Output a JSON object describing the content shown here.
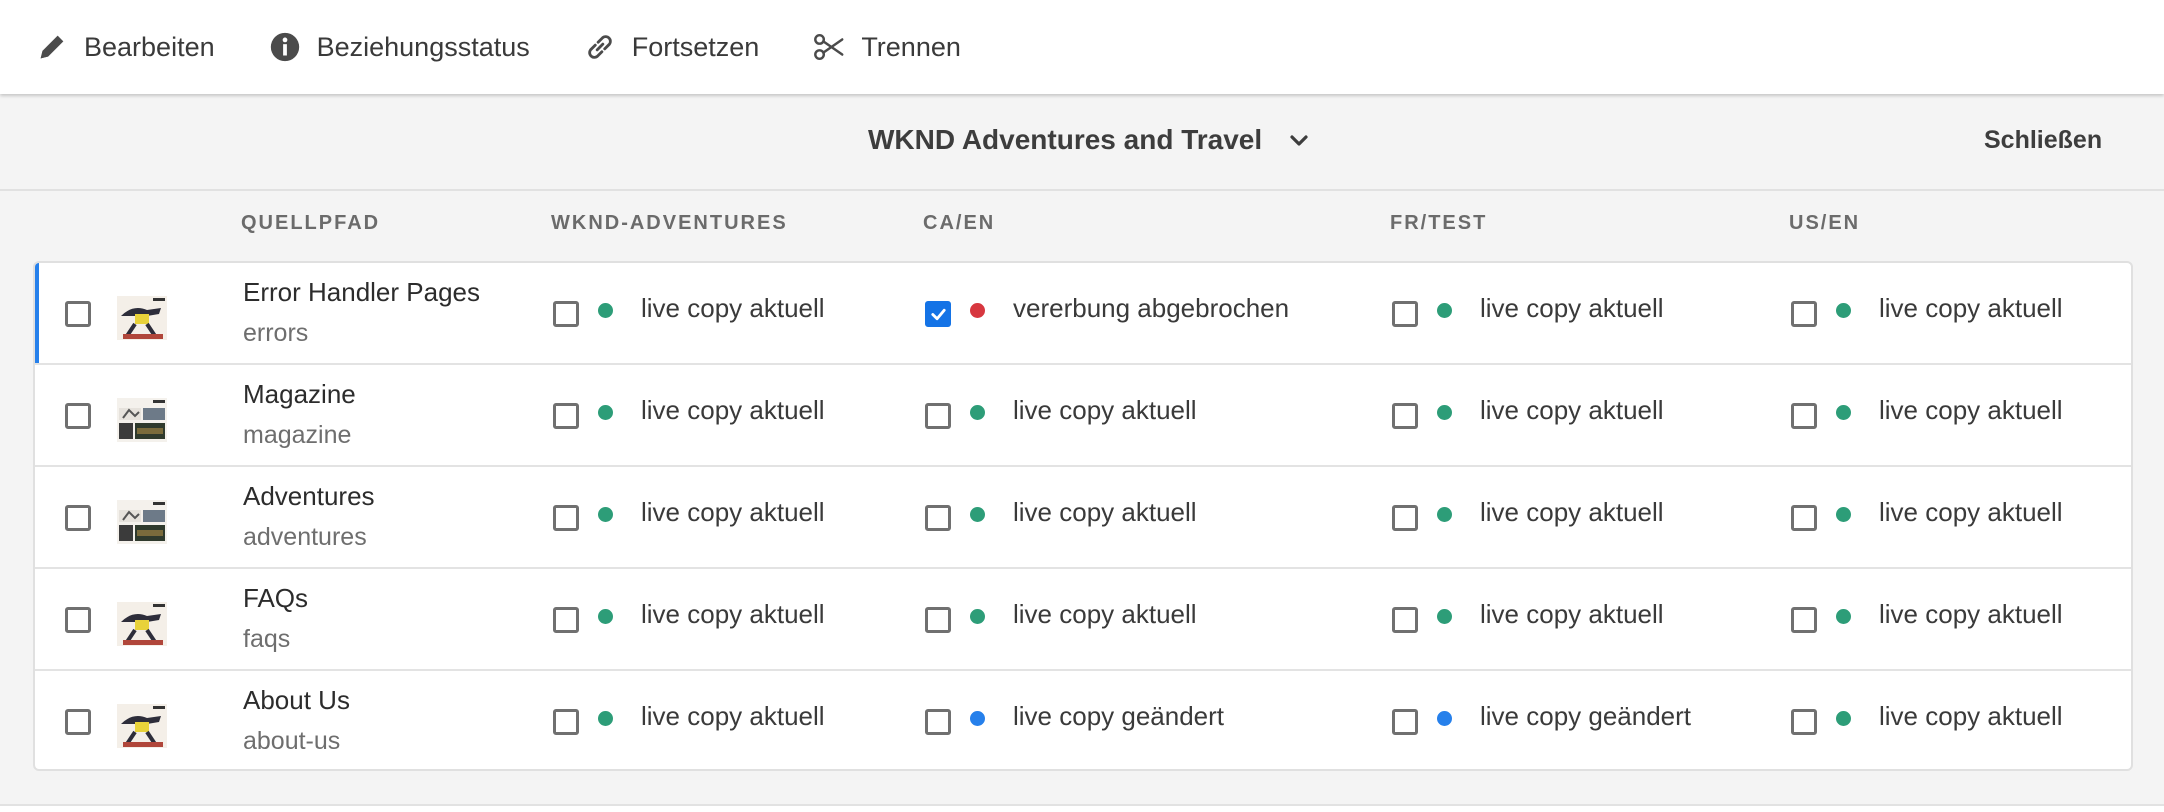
{
  "toolbar": {
    "items": [
      {
        "label": "Bearbeiten",
        "icon": "pencil-icon"
      },
      {
        "label": "Beziehungsstatus",
        "icon": "info-icon"
      },
      {
        "label": "Fortsetzen",
        "icon": "link-icon"
      },
      {
        "label": "Trennen",
        "icon": "scissors-icon"
      }
    ]
  },
  "panel": {
    "site_title": "WKND Adventures and Travel",
    "close_label": "Schließen"
  },
  "columns": {
    "source": "QUELLPFAD",
    "live_copies": [
      "WKND-ADVENTURES",
      "CA/EN",
      "FR/TEST",
      "US/EN"
    ]
  },
  "colors": {
    "status_ok": "#2d9d78",
    "status_broken": "#d7373f",
    "status_changed": "#2680eb",
    "selection_accent": "#2680eb"
  },
  "rows": [
    {
      "title": "Error Handler Pages",
      "path": "errors",
      "selected": true,
      "thumb": "single-figure",
      "cells": [
        {
          "text": "live copy aktuell",
          "state": "ok",
          "checked": false
        },
        {
          "text": "vererbung abgebrochen",
          "state": "broken",
          "checked": true
        },
        {
          "text": "live copy aktuell",
          "state": "ok",
          "checked": false
        },
        {
          "text": "live copy aktuell",
          "state": "ok",
          "checked": false
        }
      ]
    },
    {
      "title": "Magazine",
      "path": "magazine",
      "selected": false,
      "thumb": "collage",
      "cells": [
        {
          "text": "live copy aktuell",
          "state": "ok",
          "checked": false
        },
        {
          "text": "live copy aktuell",
          "state": "ok",
          "checked": false
        },
        {
          "text": "live copy aktuell",
          "state": "ok",
          "checked": false
        },
        {
          "text": "live copy aktuell",
          "state": "ok",
          "checked": false
        }
      ]
    },
    {
      "title": "Adventures",
      "path": "adventures",
      "selected": false,
      "thumb": "collage",
      "cells": [
        {
          "text": "live copy aktuell",
          "state": "ok",
          "checked": false
        },
        {
          "text": "live copy aktuell",
          "state": "ok",
          "checked": false
        },
        {
          "text": "live copy aktuell",
          "state": "ok",
          "checked": false
        },
        {
          "text": "live copy aktuell",
          "state": "ok",
          "checked": false
        }
      ]
    },
    {
      "title": "FAQs",
      "path": "faqs",
      "selected": false,
      "thumb": "single-figure",
      "cells": [
        {
          "text": "live copy aktuell",
          "state": "ok",
          "checked": false
        },
        {
          "text": "live copy aktuell",
          "state": "ok",
          "checked": false
        },
        {
          "text": "live copy aktuell",
          "state": "ok",
          "checked": false
        },
        {
          "text": "live copy aktuell",
          "state": "ok",
          "checked": false
        }
      ]
    },
    {
      "title": "About Us",
      "path": "about-us",
      "selected": false,
      "thumb": "single-figure",
      "cells": [
        {
          "text": "live copy aktuell",
          "state": "ok",
          "checked": false
        },
        {
          "text": "live copy geändert",
          "state": "changed",
          "checked": false
        },
        {
          "text": "live copy geändert",
          "state": "changed",
          "checked": false
        },
        {
          "text": "live copy aktuell",
          "state": "ok",
          "checked": false
        }
      ]
    }
  ]
}
